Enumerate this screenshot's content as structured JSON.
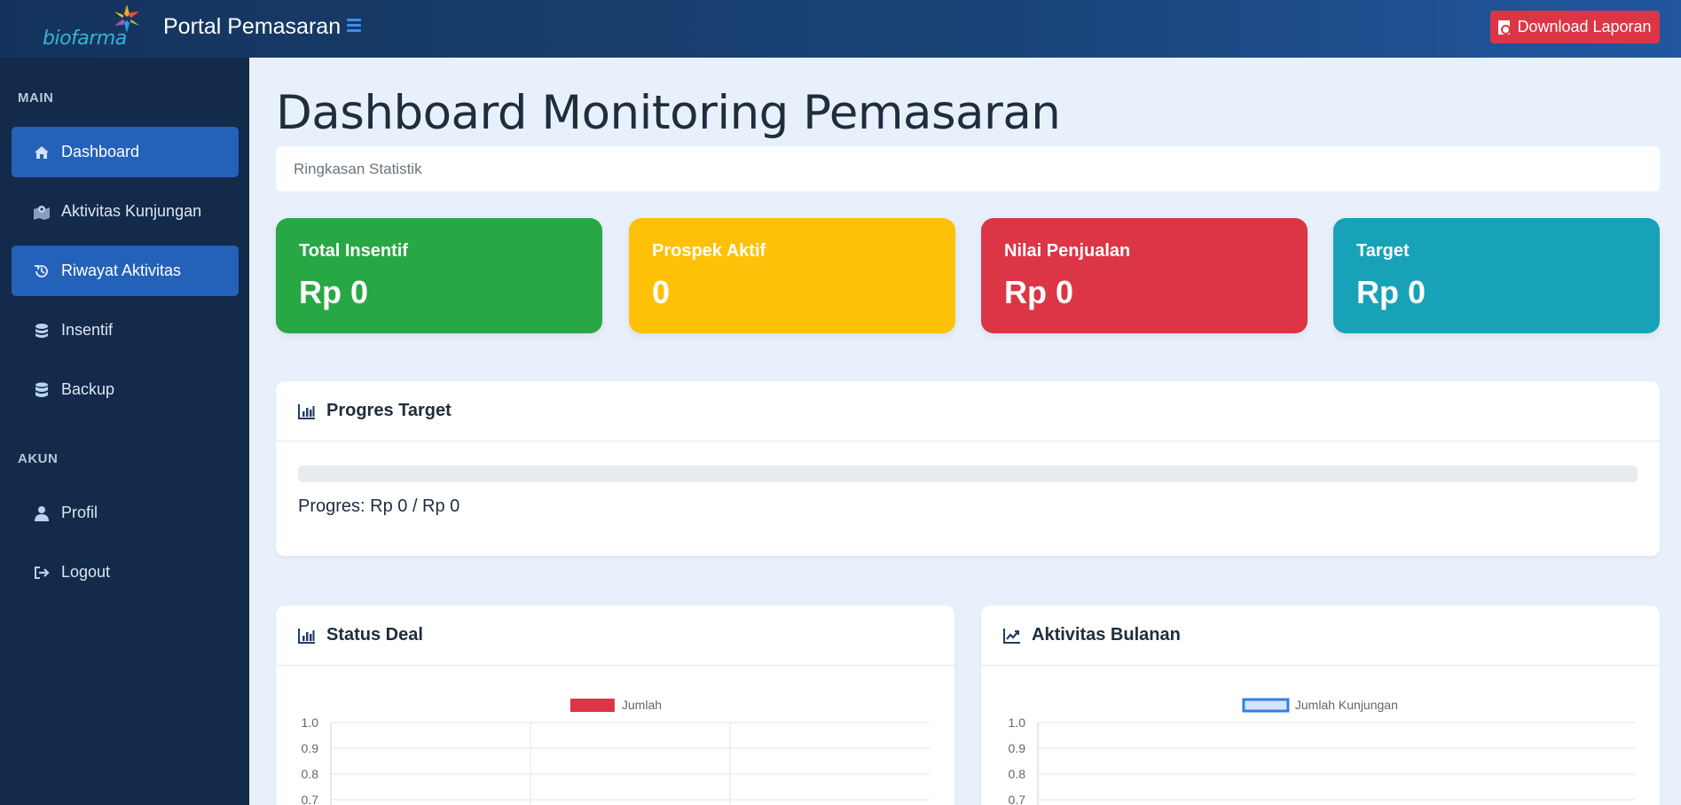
{
  "header": {
    "logo_text": "biofarma",
    "title": "Portal Pemasaran",
    "download_label": "Download Laporan"
  },
  "sidebar": {
    "sections": [
      {
        "label": "MAIN"
      },
      {
        "label": "AKUN"
      }
    ],
    "items": [
      {
        "label": "Dashboard",
        "icon": "home-icon",
        "active": true
      },
      {
        "label": "Aktivitas Kunjungan",
        "icon": "map-marker-icon",
        "active": false
      },
      {
        "label": "Riwayat Aktivitas",
        "icon": "history-icon",
        "active": true
      },
      {
        "label": "Insentif",
        "icon": "coins-icon",
        "active": false
      },
      {
        "label": "Backup",
        "icon": "database-icon",
        "active": false
      },
      {
        "label": "Profil",
        "icon": "user-icon",
        "active": false
      },
      {
        "label": "Logout",
        "icon": "logout-icon",
        "active": false
      }
    ]
  },
  "main": {
    "title": "Dashboard Monitoring Pemasaran",
    "breadcrumb": "Ringkasan Statistik",
    "stats": [
      {
        "label": "Total Insentif",
        "value": "Rp 0",
        "color": "#28a745"
      },
      {
        "label": "Prospek Aktif",
        "value": "0",
        "color": "#ffc107"
      },
      {
        "label": "Nilai Penjualan",
        "value": "Rp 0",
        "color": "#dc3545"
      },
      {
        "label": "Target",
        "value": "Rp 0",
        "color": "#17a2b8"
      }
    ],
    "progress": {
      "title": "Progres Target",
      "text": "Progres: Rp 0 / Rp 0",
      "fraction": 0
    },
    "panels": {
      "status_deal_title": "Status Deal",
      "aktivitas_title": "Aktivitas Bulanan"
    }
  },
  "colors": {
    "sidebar_bg": "#132a4a",
    "accent": "#2461b8",
    "danger": "#dc3545"
  },
  "chart_data": [
    {
      "type": "bar",
      "title": "",
      "series": [
        {
          "name": "Jumlah",
          "values": [],
          "color": "#dc3545"
        }
      ],
      "categories": [],
      "y_ticks": [
        "1.0",
        "0.9",
        "0.8",
        "0.7"
      ],
      "legend": "top",
      "grid": true
    },
    {
      "type": "line",
      "title": "",
      "series": [
        {
          "name": "Jumlah Kunjungan",
          "values": [],
          "color": "#2f80ed"
        }
      ],
      "categories": [],
      "y_ticks": [
        "1.0",
        "0.9",
        "0.8",
        "0.7"
      ],
      "legend": "top",
      "grid": true
    }
  ]
}
